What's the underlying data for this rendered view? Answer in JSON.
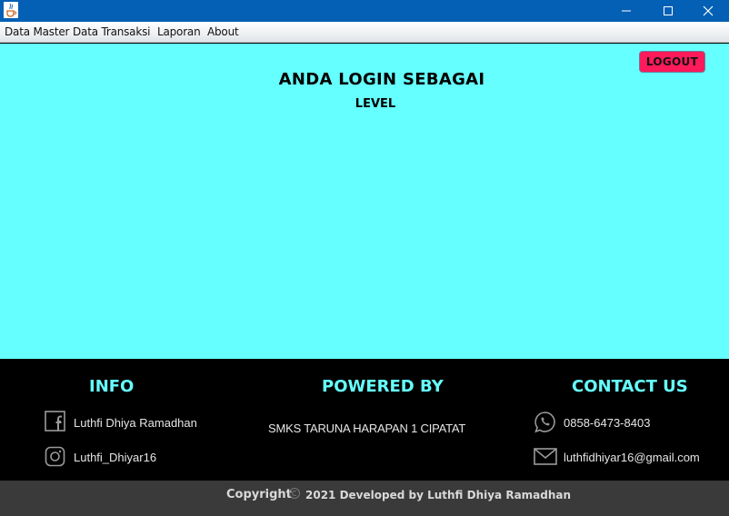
{
  "window": {
    "app_icon": "java-cup-icon",
    "controls": [
      "minimize-icon",
      "maximize-icon",
      "close-icon"
    ]
  },
  "menubar": {
    "items": [
      {
        "label": "Data Master"
      },
      {
        "label": "Data Transaksi"
      },
      {
        "label": "Laporan"
      },
      {
        "label": "About"
      }
    ]
  },
  "main": {
    "background": "#66ffff",
    "logout_label": "LOGOUT",
    "logout_color": "#ff1a5b",
    "login_title": "ANDA LOGIN SEBAGAI",
    "level_label": "LEVEL"
  },
  "footer": {
    "info": {
      "heading": "INFO",
      "facebook": "Luthfi Dhiya Ramadhan",
      "instagram": "Luthfi_Dhiyar16"
    },
    "powered": {
      "heading": "POWERED BY",
      "name": "SMKS TARUNA HARAPAN 1 CIPATAT"
    },
    "contact": {
      "heading": "CONTACT US",
      "phone": "0858-6473-8403",
      "email": "luthfidhiyar16@gmail.com"
    },
    "accent": "#66ffff"
  },
  "copyright": {
    "label": "Copyright",
    "text": "2021 Developed by Luthfi Dhiya Ramadhan"
  }
}
